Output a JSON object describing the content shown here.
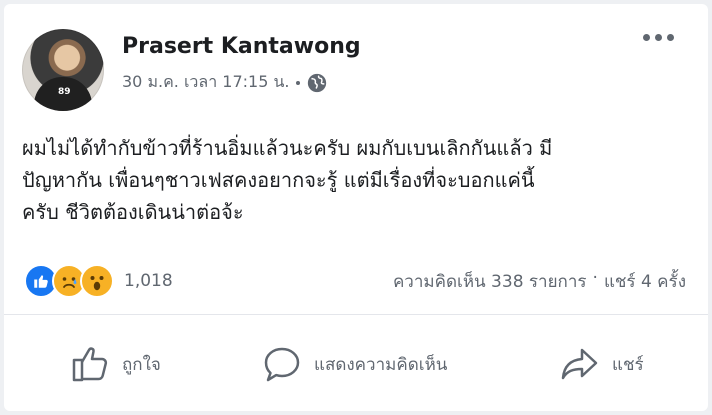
{
  "post": {
    "author": "Prasert Kantawong",
    "date": "30 ม.ค. เวลา 17:15 น.",
    "privacy_icon": "globe-icon",
    "text_lines": [
      "ผมไม่ได้ทำกับข้าวที่ร้านอิ่มแล้วนะครับ ผมกับเบนเลิกกันแล้ว มี",
      "ปัญหากัน เพื่อนๆชาวเฟสคงอยากจะรู้ แต่มีเรื่องที่จะบอกแค่นี้",
      "ครับ ชีวิตต้องเดินน่าต่อจ้ะ"
    ],
    "avatar_shirt_text": "89"
  },
  "reactions": {
    "icons": [
      "like-icon",
      "sad-icon",
      "wow-icon"
    ],
    "count": "1,018",
    "comments": "ความคิดเห็น 338 รายการ",
    "separator": "·",
    "shares": "แชร์ 4 ครั้ง"
  },
  "actions": {
    "like": "ถูกใจ",
    "comment": "แสดงความคิดเห็น",
    "share": "แชร์"
  },
  "colors": {
    "like_blue": "#1877f2",
    "reaction_yellow": "#f7b125",
    "secondary_text": "#606770"
  }
}
